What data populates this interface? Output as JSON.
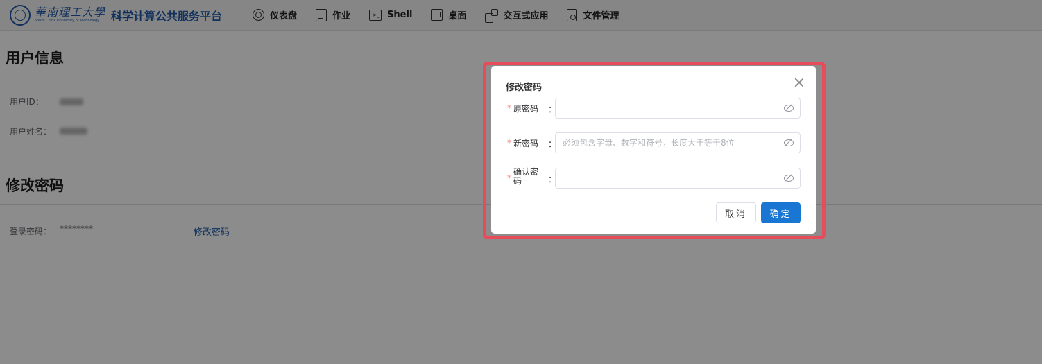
{
  "header": {
    "university_cn": "華南理工大學",
    "university_en": "South China University of Technology",
    "platform_title": "科学计算公共服务平台",
    "nav": [
      {
        "icon": "dashboard-icon",
        "label": "仪表盘"
      },
      {
        "icon": "job-icon",
        "label": "作业"
      },
      {
        "icon": "shell-icon",
        "label": "Shell"
      },
      {
        "icon": "desktop-icon",
        "label": "桌面"
      },
      {
        "icon": "apps-icon",
        "label": "交互式应用"
      },
      {
        "icon": "file-icon",
        "label": "文件管理"
      }
    ]
  },
  "user_info": {
    "title": "用户信息",
    "user_id_label": "用户ID：",
    "user_name_label": "用户姓名："
  },
  "password_section": {
    "title": "修改密码",
    "login_password_label": "登录密码：",
    "login_password_value": "********",
    "change_link": "修改密码"
  },
  "dialog": {
    "title": "修改密码",
    "fields": [
      {
        "label": "原密码",
        "placeholder": "",
        "value": ""
      },
      {
        "label": "新密码",
        "placeholder": "必须包含字母、数字和符号，长度大于等于8位",
        "value": ""
      },
      {
        "label": "确认密码",
        "placeholder": "",
        "value": ""
      }
    ],
    "colon": "：",
    "required_mark": "*",
    "cancel_label": "取消",
    "confirm_label": "确定"
  },
  "colors": {
    "brand": "#1f5aa8",
    "primary_button": "#1976d2",
    "highlight_border": "#e74c5a"
  }
}
